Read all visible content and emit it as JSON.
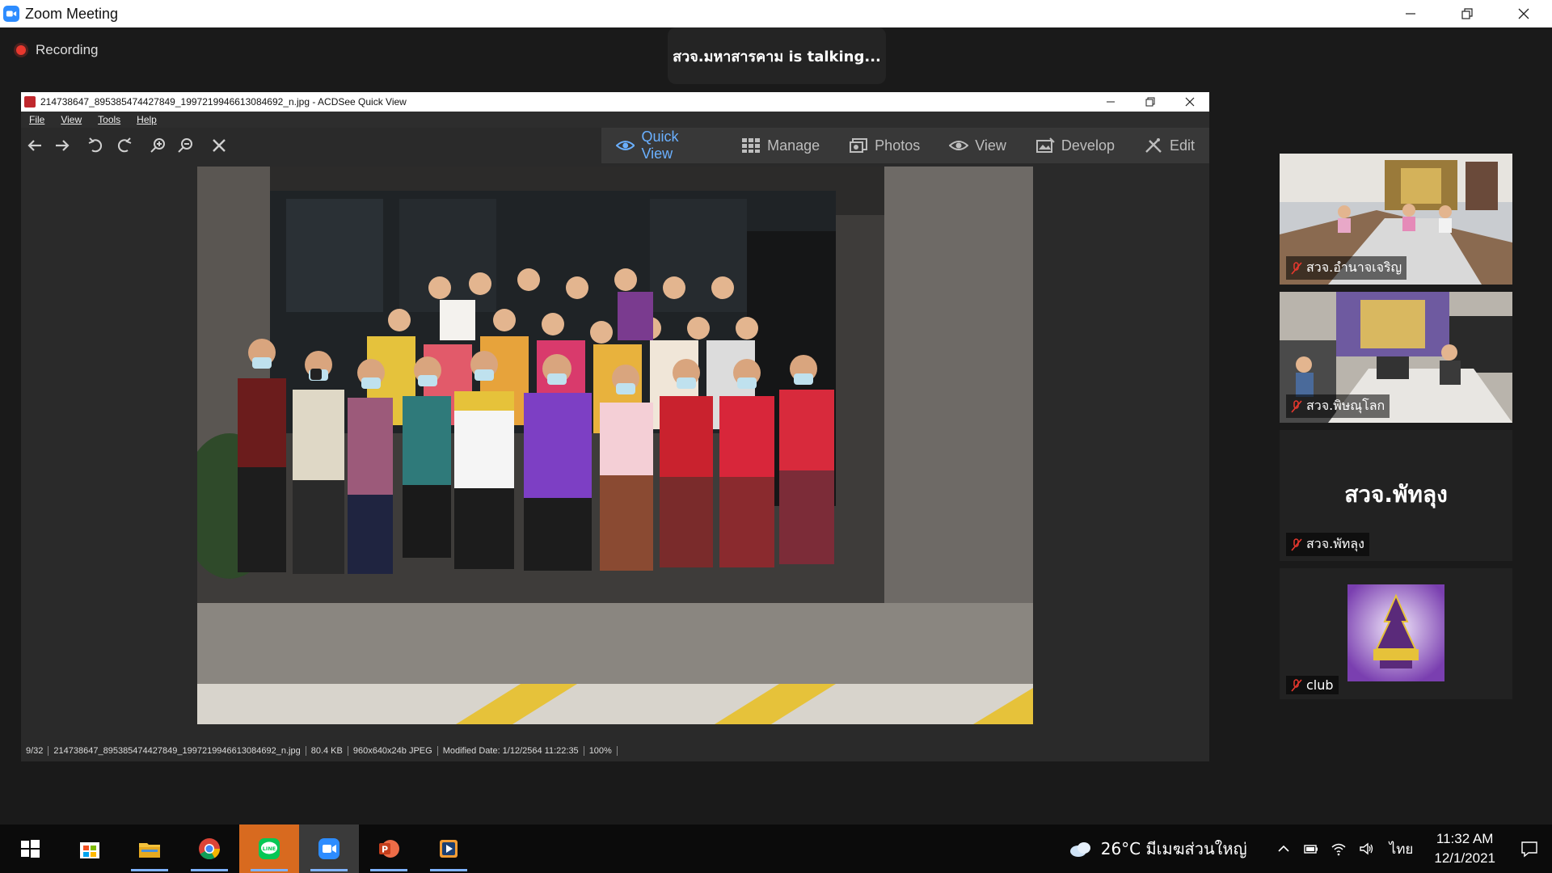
{
  "zoom": {
    "title": "Zoom Meeting",
    "recording_label": "Recording",
    "talking_banner": "สวจ.มหาสารคาม is talking..."
  },
  "acdsee": {
    "title": "214738647_895385474427849_1997219946613084692_n.jpg - ACDSee Quick View",
    "menu": [
      "File",
      "View",
      "Tools",
      "Help"
    ],
    "modes": [
      {
        "label": "Quick View",
        "icon": "eye-icon",
        "active": true
      },
      {
        "label": "Manage",
        "icon": "grid-icon",
        "active": false
      },
      {
        "label": "Photos",
        "icon": "photos-icon",
        "active": false
      },
      {
        "label": "View",
        "icon": "eye-icon",
        "active": false
      },
      {
        "label": "Develop",
        "icon": "develop-icon",
        "active": false
      },
      {
        "label": "Edit",
        "icon": "edit-icon",
        "active": false
      }
    ],
    "status": {
      "index": "9/32",
      "filename": "214738647_895385474427849_1997219946613084692_n.jpg",
      "size": "80.4 KB",
      "format": "960x640x24b JPEG",
      "modified": "Modified Date: 1/12/2564 11:22:35",
      "zoom": "100%"
    }
  },
  "participants": [
    {
      "name": "สวจ.อำนาจเจริญ",
      "muted": true,
      "type": "video"
    },
    {
      "name": "สวจ.พิษณุโลก",
      "muted": true,
      "type": "video"
    },
    {
      "name": "สวจ.พัทลุง",
      "display_name": "สวจ.พัทลุง",
      "muted": true,
      "type": "name"
    },
    {
      "name": "club",
      "muted": true,
      "type": "logo"
    }
  ],
  "taskbar": {
    "apps": [
      "start",
      "store",
      "file-explorer",
      "chrome",
      "line",
      "zoom",
      "powerpoint",
      "media-player"
    ],
    "weather": "26°C  มีเมฆส่วนใหญ่",
    "language": "ไทย",
    "time": "11:32 AM",
    "date": "12/1/2021"
  },
  "colors": {
    "accent": "#6ab0ff",
    "zoom_blue": "#2d8cff",
    "record_red": "#e8382e",
    "line_green": "#06c755",
    "taskbar_orange": "#d86a1f"
  }
}
